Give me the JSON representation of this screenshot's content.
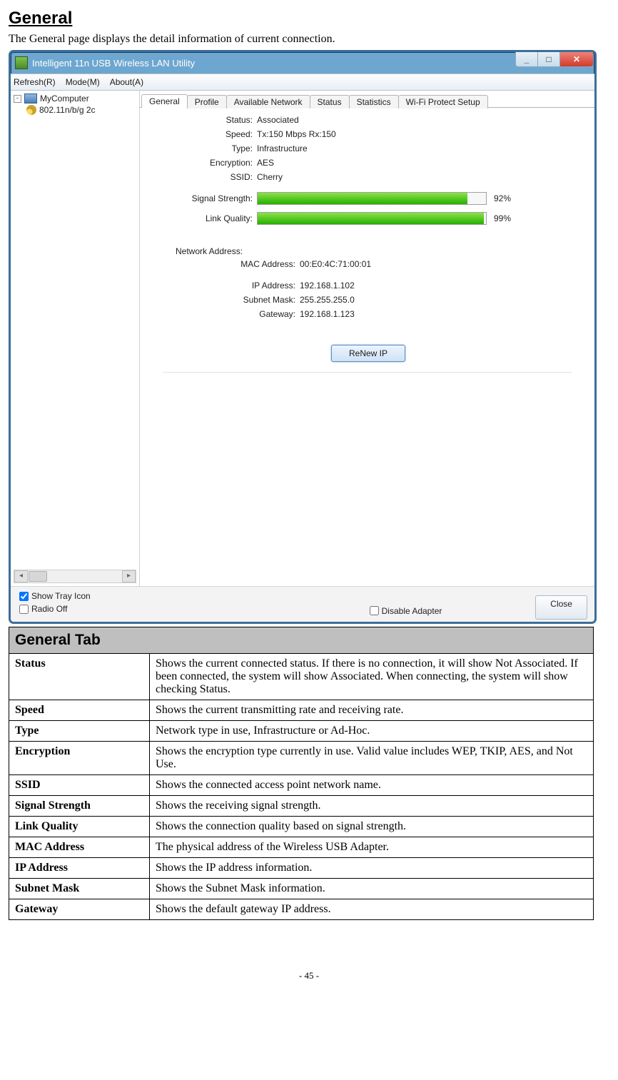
{
  "page": {
    "title": "General",
    "intro": "The General page displays the detail information of current connection.",
    "page_number": "- 45 -"
  },
  "window": {
    "title": "Intelligent 11n USB Wireless LAN Utility",
    "menubar": {
      "refresh": "Refresh(R)",
      "mode": "Mode(M)",
      "about": "About(A)"
    },
    "tree": {
      "root": "MyComputer",
      "child": "802.11n/b/g 2c",
      "scroll_thumb_marker": ""
    },
    "tabs": [
      "General",
      "Profile",
      "Available Network",
      "Status",
      "Statistics",
      "Wi-Fi Protect Setup"
    ],
    "status": {
      "status_label": "Status:",
      "status_value": "Associated",
      "speed_label": "Speed:",
      "speed_value": "Tx:150 Mbps Rx:150",
      "type_label": "Type:",
      "type_value": "Infrastructure",
      "encryption_label": "Encryption:",
      "encryption_value": "AES",
      "ssid_label": "SSID:",
      "ssid_value": "Cherry",
      "signal_label": "Signal Strength:",
      "signal_percent": "92%",
      "link_label": "Link Quality:",
      "link_percent": "99%"
    },
    "netaddr": {
      "section": "Network Address:",
      "mac_label": "MAC Address:",
      "mac_value": "00:E0:4C:71:00:01",
      "ip_label": "IP Address:",
      "ip_value": "192.168.1.102",
      "mask_label": "Subnet Mask:",
      "mask_value": "255.255.255.0",
      "gw_label": "Gateway:",
      "gw_value": "192.168.1.123"
    },
    "renew_button": "ReNew IP",
    "bottombar": {
      "show_tray": "Show Tray Icon",
      "radio_off": "Radio Off",
      "disable_adapter": "Disable Adapter",
      "close": "Close"
    }
  },
  "table": {
    "header": "General Tab",
    "rows": [
      {
        "key": "Status",
        "val": "Shows the current connected status. If there is no connection, it will show Not Associated. If been connected, the system will show Associated. When connecting, the system will show checking Status."
      },
      {
        "key": "Speed",
        "val": "Shows the current transmitting rate and receiving rate."
      },
      {
        "key": "Type",
        "val": "Network type in use, Infrastructure or Ad-Hoc."
      },
      {
        "key": "Encryption",
        "val": "Shows the encryption type currently in use. Valid value includes WEP, TKIP, AES, and Not Use."
      },
      {
        "key": "SSID",
        "val": "Shows the connected access point network name."
      },
      {
        "key": "Signal Strength",
        "val": "Shows the receiving signal strength."
      },
      {
        "key": "Link Quality",
        "val": "Shows the connection quality based on signal strength."
      },
      {
        "key": "MAC Address",
        "val": "The physical address of the Wireless USB Adapter."
      },
      {
        "key": "IP Address",
        "val": "Shows the IP address information."
      },
      {
        "key": "Subnet Mask",
        "val": "Shows the Subnet Mask information."
      },
      {
        "key": "Gateway",
        "val": "Shows the default gateway IP address."
      }
    ]
  },
  "chart_data": {
    "type": "bar",
    "categories": [
      "Signal Strength",
      "Link Quality"
    ],
    "values": [
      92,
      99
    ],
    "title": "",
    "xlabel": "",
    "ylabel": "",
    "ylim": [
      0,
      100
    ]
  }
}
